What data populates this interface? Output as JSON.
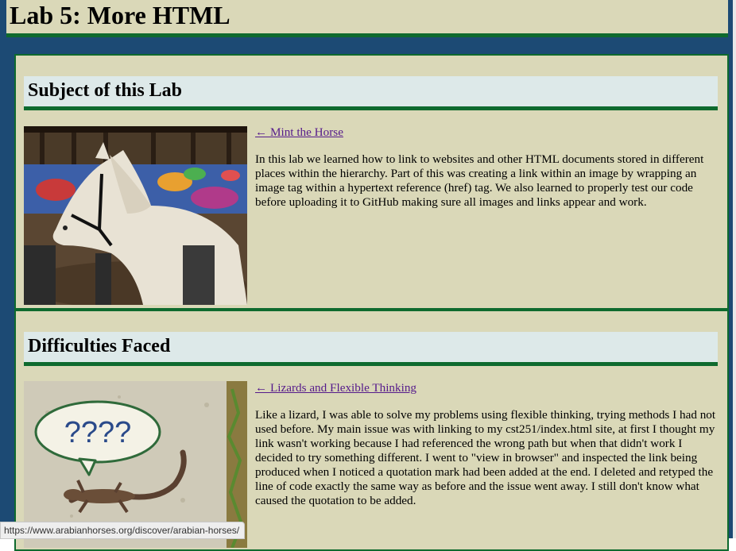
{
  "header": {
    "title": "Lab 5: More HTML"
  },
  "sections": [
    {
      "heading": "Subject of this Lab",
      "link": "← Mint the Horse",
      "image_icon": "horse-photo",
      "text": "In this lab we learned how to link to websites and other HTML documents stored in different places within the hierarchy. Part of this was creating a link within an image by wrapping an image tag within a hypertext reference (href) tag. We also learned to properly test our code before uploading it to GitHub making sure all images and links appear and work."
    },
    {
      "heading": "Difficulties Faced",
      "link": "← Lizards and Flexible Thinking",
      "image_icon": "lizard-photo",
      "bubble_text": "????",
      "text": "Like a lizard, I was able to solve my problems using flexible thinking, trying methods I had not used before. My main issue was with linking to my cst251/index.html site, at first I thought my link wasn't working because I had referenced the wrong path but when that didn't work I decided to try something different. I went to \"view in browser\" and inspected the link being produced when I noticed a quotation mark had been added at the end. I deleted and retyped the line of code exactly the same way as before and the issue went away. I still don't know what caused the quotation to be added."
    }
  ],
  "status_bar": {
    "url": "https://www.arabianhorses.org/discover/arabian-horses/"
  },
  "colors": {
    "frame": "#1c4a74",
    "panel": "#dad8b8",
    "heading_bg": "#dde9e9",
    "accent_green": "#0e6a2e",
    "visited_link": "#551a8b"
  }
}
